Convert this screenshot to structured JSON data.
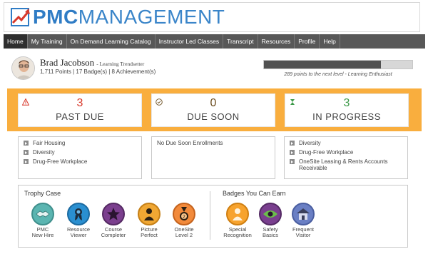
{
  "brand": {
    "name_bold": "PMC",
    "name_rest": "MANAGEMENT",
    "colors": {
      "blue": "#2f7cc5",
      "red": "#d8392b",
      "orange": "#f9ae3e"
    }
  },
  "nav": {
    "items": [
      {
        "label": "Home",
        "active": true
      },
      {
        "label": "My Training"
      },
      {
        "label": "On Demand Learning Catalog"
      },
      {
        "label": "Instructor Led Classes"
      },
      {
        "label": "Transcript"
      },
      {
        "label": "Resources"
      },
      {
        "label": "Profile"
      },
      {
        "label": "Help"
      }
    ]
  },
  "profile": {
    "name": "Brad Jacobson",
    "title": "- Learning Trendsetter",
    "stats": "1,711 Points | 17 Badge(s) | 8 Achievement(s)",
    "level_progress": 0.79,
    "progress_caption": "289 points to the next level - Learning Enthusiast"
  },
  "status": {
    "past_due": {
      "count": "3",
      "label": "PAST DUE",
      "color": "#d8392b",
      "icon": "warning-icon"
    },
    "due_soon": {
      "count": "0",
      "label": "DUE SOON",
      "color": "#6b4d1f",
      "icon": "clock-icon"
    },
    "in_progress": {
      "count": "3",
      "label": "IN PROGRESS",
      "color": "#3d9a4a",
      "icon": "hourglass-icon"
    }
  },
  "lists": {
    "past_due": [
      "Fair Housing",
      "Diversity",
      "Drug-Free Workplace"
    ],
    "due_soon_empty": "No Due Soon Enrollments",
    "in_progress": [
      "Diversity",
      "Drug-Free Workplace",
      "OneSite Leasing & Rents Accounts Receivable"
    ]
  },
  "trophy_case": {
    "title": "Trophy Case",
    "badges": [
      {
        "line1": "PMC",
        "line2": "New Hire",
        "icon": "handshake-icon",
        "color": "#5bb5b1"
      },
      {
        "line1": "Resource",
        "line2": "Viewer",
        "icon": "ribbon-icon",
        "color": "#2a8fd0"
      },
      {
        "line1": "Course",
        "line2": "Completer",
        "icon": "star-icon",
        "color": "#7b3f8e"
      },
      {
        "line1": "Picture",
        "line2": "Perfect",
        "icon": "person-icon",
        "color": "#f0a733"
      },
      {
        "line1": "OneSite",
        "line2": "Level 2",
        "icon": "medal-icon",
        "color": "#f28a3b"
      }
    ]
  },
  "badges_you_can_earn": {
    "title": "Badges You Can Earn",
    "badges": [
      {
        "line1": "Special",
        "line2": "Recognition",
        "icon": "person-icon",
        "color": "#f7a32e"
      },
      {
        "line1": "Safety",
        "line2": "Basics",
        "icon": "eye-icon",
        "color": "#7a3f8f"
      },
      {
        "line1": "Frequent",
        "line2": "Visitor",
        "icon": "house-icon",
        "color": "#6a7fc4"
      }
    ]
  }
}
